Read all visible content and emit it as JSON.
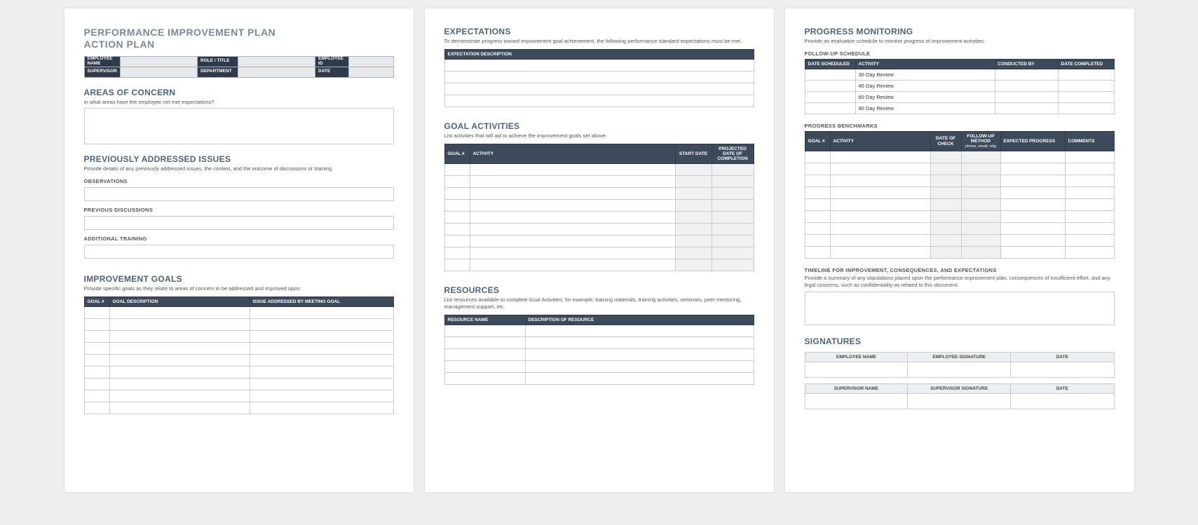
{
  "page1": {
    "title1": "PERFORMANCE IMPROVEMENT PLAN",
    "title2": "ACTION PLAN",
    "info": {
      "employee_name": "EMPLOYEE NAME",
      "role": "ROLE / TITLE",
      "employee_id": "EMPLOYEE ID",
      "supervisor": "SUPERVISOR",
      "department": "DEPARTMENT",
      "date": "DATE"
    },
    "areas": {
      "heading": "AREAS OF CONCERN",
      "desc": "In what areas have the employee not met expectations?"
    },
    "prev": {
      "heading": "PREVIOUSLY ADDRESSED ISSUES",
      "desc": "Provide details of any previously addressed issues, the context, and the outcome of discussions or training.",
      "observations": "OBSERVATIONS",
      "discussions": "PREVIOUS DISCUSSIONS",
      "training": "ADDITIONAL TRAINING"
    },
    "goals": {
      "heading": "IMPROVEMENT GOALS",
      "desc": "Provide specific goals as they relate to areas of concern to be addressed and improved upon.",
      "cols": {
        "num": "GOAL #",
        "desc": "GOAL DESCRIPTION",
        "issue": "ISSUE ADDRESSED BY MEETING GOAL"
      }
    }
  },
  "page2": {
    "expect": {
      "heading": "EXPECTATIONS",
      "desc": "To demonstrate progress toward improvement goal achievement, the following performance standard expectations must be met.",
      "col": "EXPECTATION DESCRIPTION"
    },
    "activities": {
      "heading": "GOAL ACTIVITIES",
      "desc": "List activities that will aid to achieve the improvement goals set above.",
      "cols": {
        "num": "GOAL #",
        "act": "ACTIVITY",
        "start": "START DATE",
        "proj": "PROJECTED DATE OF COMPLETION"
      }
    },
    "resources": {
      "heading": "RESOURCES",
      "desc": "List resources available to complete Goal Activities; for example: training materials, training activities, seminars, peer mentoring, management support, etc.",
      "cols": {
        "name": "RESOURCE NAME",
        "desc": "DESCRIPTION OF RESOURCE"
      }
    }
  },
  "page3": {
    "monitor": {
      "heading": "PROGRESS MONITORING",
      "desc": "Provide an evaluation schedule to monitor progress of improvement activities."
    },
    "followup": {
      "sub": "FOLLOW-UP SCHEDULE",
      "cols": {
        "date": "DATE SCHEDULED",
        "act": "ACTIVITY",
        "by": "CONDUCTED BY",
        "done": "DATE COMPLETED"
      },
      "rows": [
        "30 Day Review",
        "45 Day Review",
        "60 Day Review",
        "90 Day Review"
      ]
    },
    "bench": {
      "sub": "PROGRESS BENCHMARKS",
      "cols": {
        "num": "GOAL #",
        "act": "ACTIVITY",
        "check": "DATE OF CHECK",
        "method": "FOLLOW-UP METHOD",
        "method_sub": "phone, email, mtg",
        "exp": "EXPECTED PROGRESS",
        "com": "COMMENTS"
      }
    },
    "timeline": {
      "sub": "TIMELINE FOR IMPROVEMENT, CONSEQUENCES, AND EXPECTATIONS",
      "desc": "Provide a summary of any stipulations placed upon the performance improvement plan, consequences of insufficient effort, and any legal concerns, such as confidentiality as related to this document."
    },
    "sign": {
      "heading": "SIGNATURES",
      "emp": {
        "name": "EMPLOYEE NAME",
        "sig": "EMPLOYEE SIGNATURE",
        "date": "DATE"
      },
      "sup": {
        "name": "SUPERVISOR NAME",
        "sig": "SUPERVISOR SIGNATURE",
        "date": "DATE"
      }
    }
  }
}
